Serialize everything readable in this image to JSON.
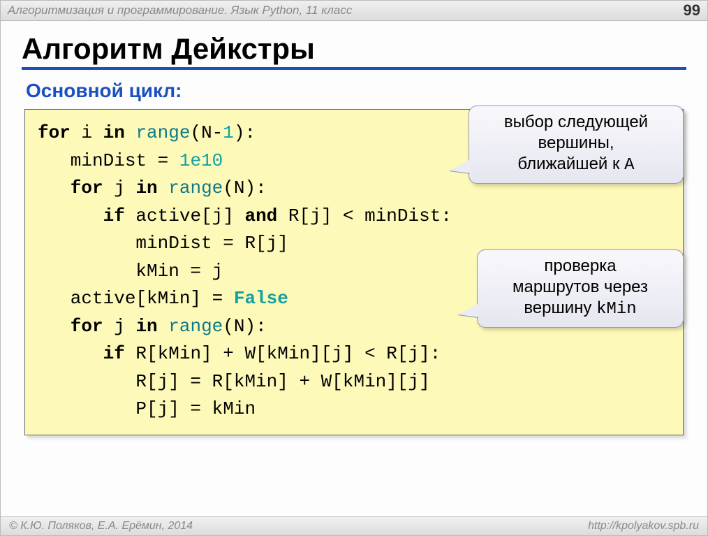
{
  "header": {
    "course": "Алгоритмизация и программирование. Язык Python, 11 класс",
    "page": "99"
  },
  "title": "Алгоритм Дейкстры",
  "subtitle": "Основной цикл:",
  "code": {
    "l1a": "for",
    "l1b": " i ",
    "l1c": "in",
    "l1d": " ",
    "l1e": "range",
    "l1f": "(N-",
    "l1g": "1",
    "l1h": "):",
    "l2a": "   minDist = ",
    "l2b": "1e10",
    "l3a": "   for",
    "l3b": " j ",
    "l3c": "in",
    "l3d": " ",
    "l3e": "range",
    "l3f": "(N):",
    "l4a": "      if",
    "l4b": " active[j] ",
    "l4c": "and",
    "l4d": " R[j] < minDist:",
    "l5": "         minDist = R[j]",
    "l6": "         kMin = j",
    "l7a": "   active[kMin] = ",
    "l7b": "False",
    "l8a": "   for",
    "l8b": " j ",
    "l8c": "in",
    "l8d": " ",
    "l8e": "range",
    "l8f": "(N):",
    "l9a": "      if",
    "l9b": " R[kMin] + W[kMin][j] < R[j]:",
    "l10": "         R[j] = R[kMin] + W[kMin][j]",
    "l11": "         P[j] = kMin"
  },
  "callout1": {
    "line1": "выбор следующей",
    "line2": "вершины,",
    "line3a": "ближайшей к ",
    "line3b": "A"
  },
  "callout2": {
    "line1": "проверка",
    "line2": "маршрутов через",
    "line3a": "вершину ",
    "line3b": "kMin"
  },
  "footer": {
    "left": "© К.Ю. Поляков, Е.А. Ерёмин, 2014",
    "right": "http://kpolyakov.spb.ru"
  }
}
